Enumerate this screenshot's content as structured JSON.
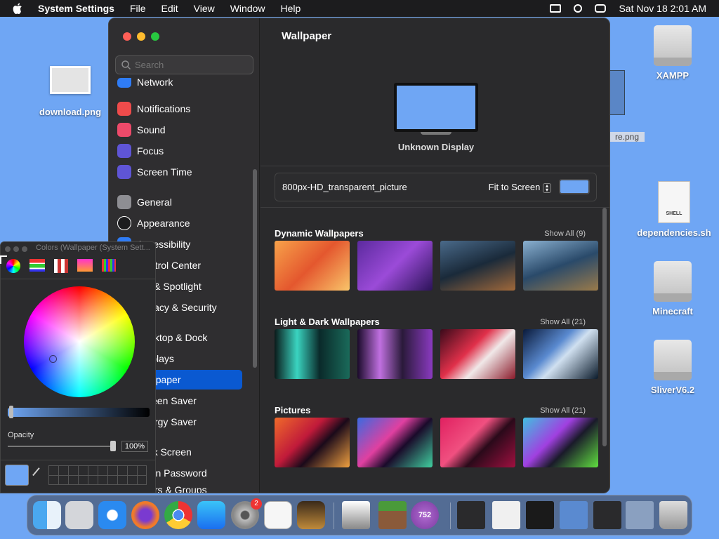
{
  "menubar": {
    "app": "System Settings",
    "items": [
      "File",
      "Edit",
      "View",
      "Window",
      "Help"
    ],
    "clock": "Sat Nov 18  2:01 AM"
  },
  "desktop": [
    {
      "label": "download.png"
    },
    {
      "label": "XAMPP"
    },
    {
      "label": "re.png"
    },
    {
      "label": "dependencies.sh"
    },
    {
      "label": "Minecraft"
    },
    {
      "label": "SliverV6.2"
    }
  ],
  "sidebar": {
    "search_placeholder": "Search",
    "items": [
      {
        "label": "Network"
      },
      {
        "label": "Notifications"
      },
      {
        "label": "Sound"
      },
      {
        "label": "Focus"
      },
      {
        "label": "Screen Time"
      },
      {
        "label": "General"
      },
      {
        "label": "Appearance"
      },
      {
        "label": "Accessibility"
      },
      {
        "label": "Control Center"
      },
      {
        "label": "Siri & Spotlight"
      },
      {
        "label": "Privacy & Security"
      },
      {
        "label": "Desktop & Dock"
      },
      {
        "label": "Displays"
      },
      {
        "label": "Wallpaper"
      },
      {
        "label": "Screen Saver"
      },
      {
        "label": "Energy Saver"
      },
      {
        "label": "Lock Screen"
      },
      {
        "label": "Login Password"
      },
      {
        "label": "Users & Groups"
      }
    ]
  },
  "main": {
    "title": "Wallpaper",
    "display": "Unknown Display",
    "file": "800px-HD_transparent_picture",
    "fit": "Fit to Screen",
    "color": "#6fa6f4",
    "sections": [
      {
        "title": "Dynamic Wallpapers",
        "show": "Show All (9)"
      },
      {
        "title": "Light & Dark Wallpapers",
        "show": "Show All (21)"
      },
      {
        "title": "Pictures",
        "show": "Show All (21)"
      }
    ]
  },
  "colors": {
    "title": "Colors (Wallpaper (System Sett...",
    "opacity_label": "Opacity",
    "opacity_value": "100%",
    "opacity": 1.0
  },
  "dock": {
    "badge_settings": "2",
    "badge_752": "752"
  }
}
